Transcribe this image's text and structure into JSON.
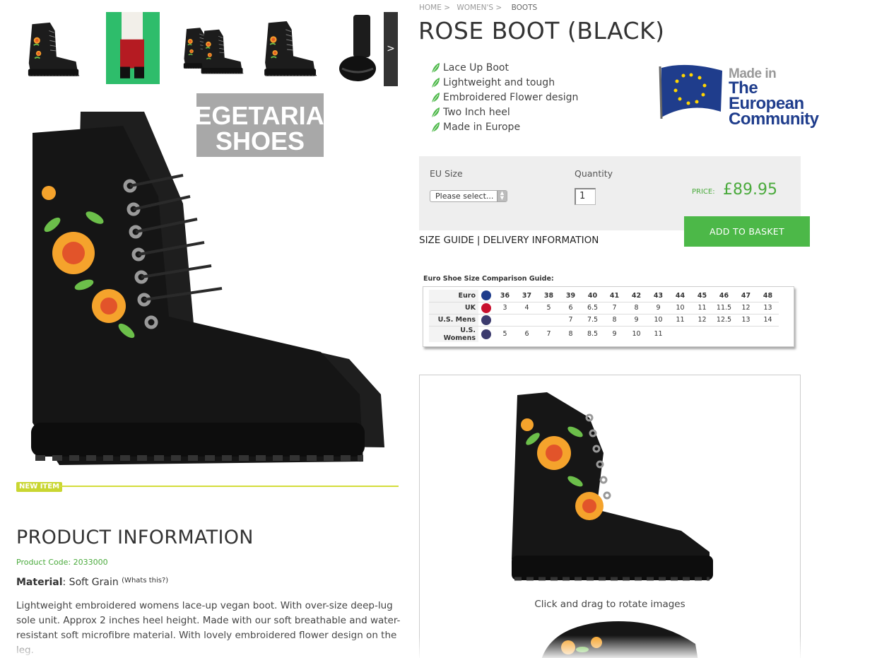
{
  "thumbnails": [
    {
      "name": "thumb-1",
      "alt": "side view boot"
    },
    {
      "name": "thumb-2",
      "alt": "model wearing boot"
    },
    {
      "name": "thumb-3",
      "alt": "pair of boots"
    },
    {
      "name": "thumb-4",
      "alt": "boot heel view"
    },
    {
      "name": "thumb-5",
      "alt": "boot sole view"
    }
  ],
  "thumb_next": ">",
  "main_image": {
    "watermark_line1": "VEGETARIAN",
    "watermark_line2": "SHOES"
  },
  "new_item_badge": "NEW ITEM",
  "product_info": {
    "heading": "PRODUCT INFORMATION",
    "code": "Product Code: 2033000",
    "material_label": "Material",
    "material_value": ": Soft Grain",
    "whats_this": "(Whats this?)",
    "description": "Lightweight embroidered womens lace-up vegan boot. With over-size deep-lug sole unit. Approx 2 inches heel height. Made with our soft breathable and water-resistant soft microfibre material. With lovely embroidered flower design on the leg."
  },
  "breadcrumb": {
    "home": "HOME >",
    "womens": "WOMEN'S >",
    "current": "BOOTS"
  },
  "title": "ROSE BOOT (BLACK)",
  "features": [
    "Lace Up Boot",
    "Lightweight and tough",
    "Embroidered Flower design",
    "Two Inch heel",
    "Made in Europe"
  ],
  "eu_badge": {
    "line1": "Made in",
    "line2": "The European",
    "line3": "Community"
  },
  "buy": {
    "size_label": "EU Size",
    "size_selected": "Please select...",
    "qty_label": "Quantity",
    "qty_value": "1",
    "price_label": "PRICE:",
    "price": "£89.95",
    "add_to_basket": "ADD TO BASKET"
  },
  "links": {
    "size_guide": "SIZE GUIDE",
    "separator": "|",
    "delivery": "DELIVERY INFORMATION"
  },
  "size_guide": {
    "heading": "Euro Shoe Size Comparison Guide:",
    "rows": [
      {
        "label": "Euro",
        "flag_color": "#1f3d8c",
        "values": [
          "36",
          "37",
          "38",
          "39",
          "40",
          "41",
          "42",
          "43",
          "44",
          "45",
          "46",
          "47",
          "48"
        ]
      },
      {
        "label": "UK",
        "flag_color": "#c8102e",
        "values": [
          "3",
          "4",
          "5",
          "6",
          "6.5",
          "7",
          "8",
          "9",
          "10",
          "11",
          "11.5",
          "12",
          "13"
        ]
      },
      {
        "label": "U.S. Mens",
        "flag_color": "#3c3b6e",
        "values": [
          "",
          "",
          "",
          "7",
          "7.5",
          "8",
          "9",
          "10",
          "11",
          "12",
          "12.5",
          "13",
          "14"
        ]
      },
      {
        "label": "U.S. Womens",
        "flag_color": "#3c3b6e",
        "values": [
          "5",
          "6",
          "7",
          "8",
          "8.5",
          "9",
          "10",
          "11",
          "",
          "",
          "",
          "",
          ""
        ]
      }
    ]
  },
  "viewer": {
    "caption": "Click and drag to rotate images"
  },
  "colors": {
    "accent_green": "#4cb848",
    "price_green": "#4aaa3c",
    "badge_yellow": "#c9d631",
    "eu_blue": "#1f3d8c"
  }
}
